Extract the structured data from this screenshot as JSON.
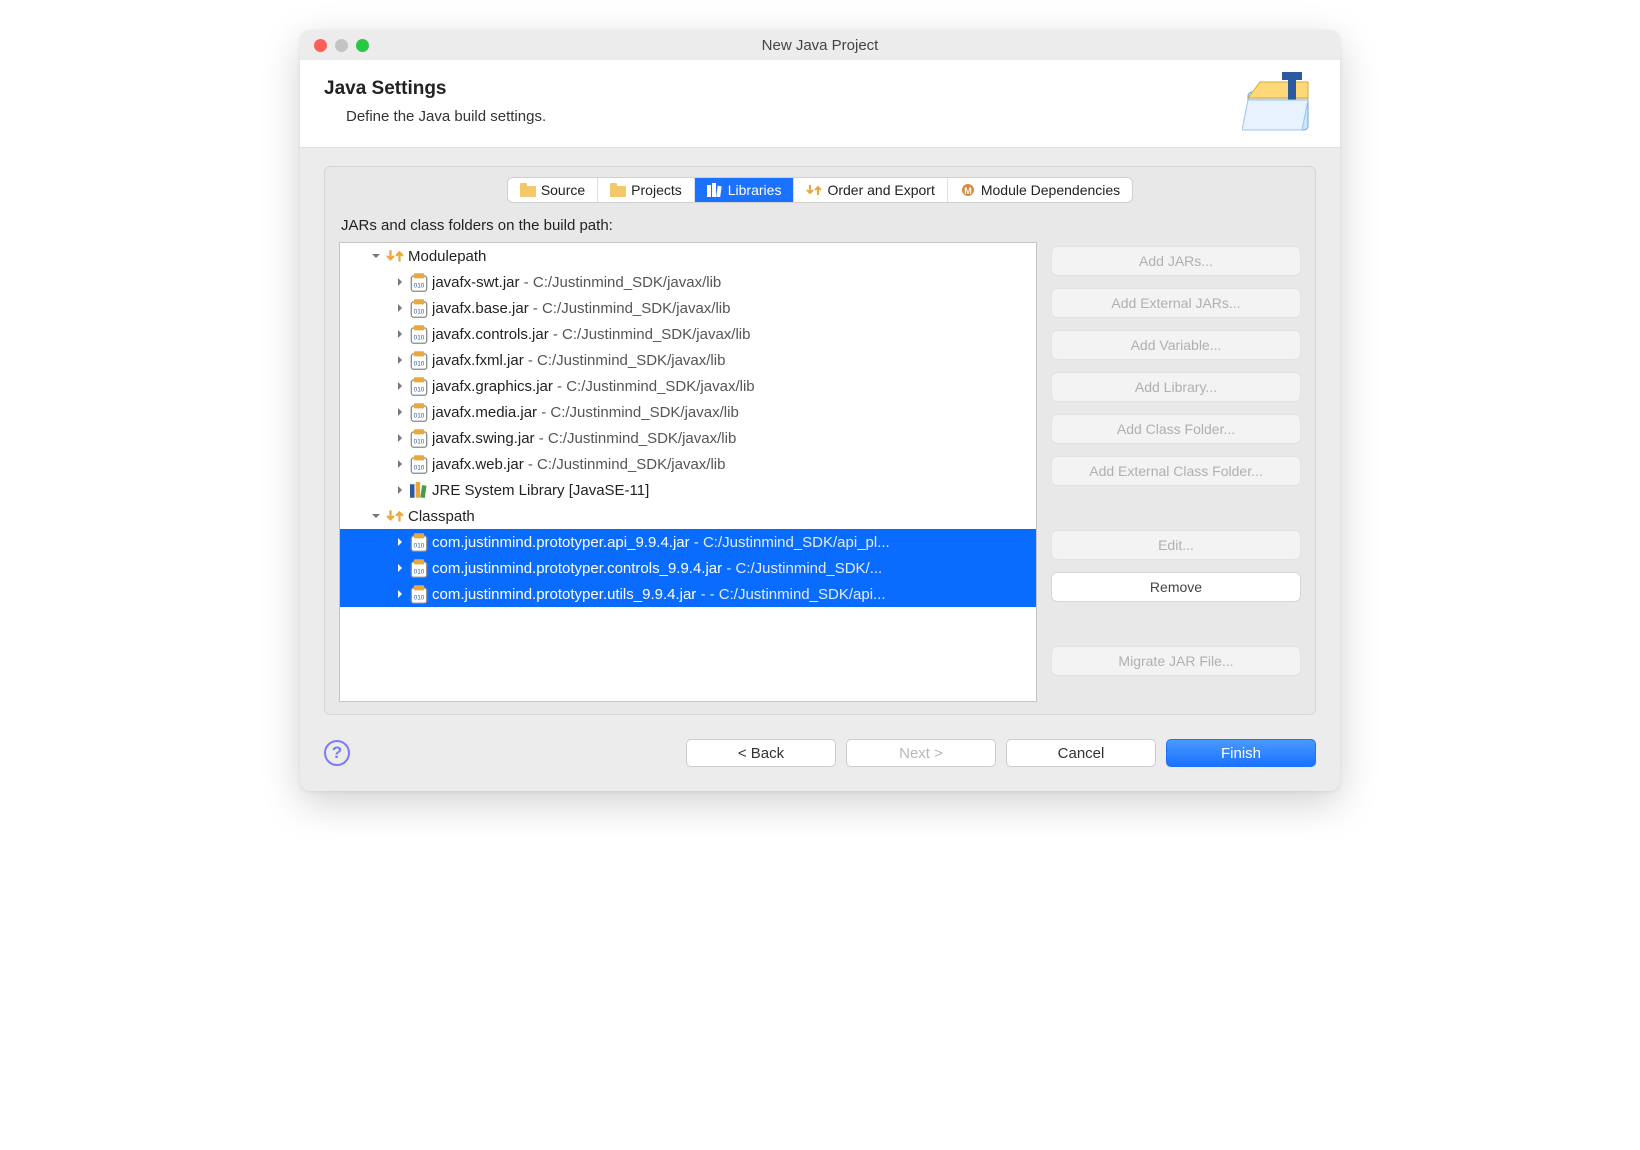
{
  "window": {
    "title": "New Java Project"
  },
  "header": {
    "title": "Java Settings",
    "subtitle": "Define the Java build settings."
  },
  "tabs": {
    "source": "Source",
    "projects": "Projects",
    "libraries": "Libraries",
    "order_export": "Order and Export",
    "module_deps": "Module Dependencies"
  },
  "libraries": {
    "label": "JARs and class folders on the build path:",
    "groups": {
      "modulepath_label": "Modulepath",
      "classpath_label": "Classpath"
    },
    "modulepath": [
      {
        "name": "javafx-swt.jar",
        "path": " - C:/Justinmind_SDK/javax/lib"
      },
      {
        "name": "javafx.base.jar",
        "path": " - C:/Justinmind_SDK/javax/lib"
      },
      {
        "name": "javafx.controls.jar",
        "path": " - C:/Justinmind_SDK/javax/lib"
      },
      {
        "name": "javafx.fxml.jar",
        "path": " - C:/Justinmind_SDK/javax/lib"
      },
      {
        "name": "javafx.graphics.jar",
        "path": " - C:/Justinmind_SDK/javax/lib"
      },
      {
        "name": "javafx.media.jar",
        "path": " - C:/Justinmind_SDK/javax/lib"
      },
      {
        "name": "javafx.swing.jar",
        "path": " - C:/Justinmind_SDK/javax/lib"
      },
      {
        "name": "javafx.web.jar",
        "path": " - C:/Justinmind_SDK/javax/lib"
      }
    ],
    "jre_label": "JRE System Library [JavaSE-11]",
    "classpath": [
      {
        "name": "com.justinmind.prototyper.api_9.9.4.jar",
        "path": "  - C:/Justinmind_SDK/api_pl..."
      },
      {
        "name": "com.justinmind.prototyper.controls_9.9.4.jar",
        "path": " - C:/Justinmind_SDK/..."
      },
      {
        "name": "com.justinmind.prototyper.utils_9.9.4.jar",
        "path": " - - C:/Justinmind_SDK/api..."
      }
    ]
  },
  "buttons": {
    "add_jars": "Add JARs...",
    "add_external_jars": "Add External JARs...",
    "add_variable": "Add Variable...",
    "add_library": "Add Library...",
    "add_class_folder": "Add Class Folder...",
    "add_external_class_folder": "Add External Class Folder...",
    "edit": "Edit...",
    "remove": "Remove",
    "migrate_jar": "Migrate JAR File..."
  },
  "footer": {
    "back": "< Back",
    "next": "Next >",
    "cancel": "Cancel",
    "finish": "Finish"
  }
}
